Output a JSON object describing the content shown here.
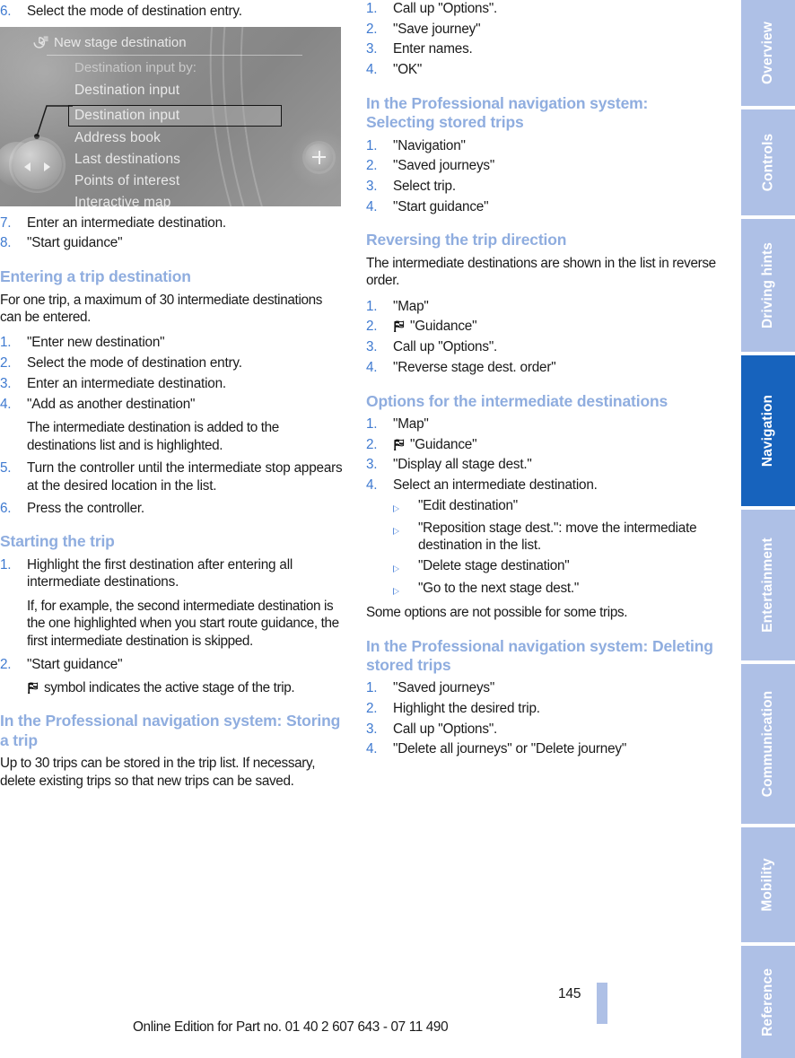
{
  "page": {
    "number": "145",
    "footer_note": "Online Edition for Part no. 01 40 2 607 643 - 07 11 490"
  },
  "colors": {
    "heading_blue": "#8faddf",
    "number_blue": "#3f7ad0",
    "tab_inactive": "#aec0e6",
    "tab_active": "#1763bd",
    "page_bar": "#aec0e6"
  },
  "idrive_screenshot": {
    "title": "New stage destination",
    "title_icon": "navigation-destination-icon",
    "subtitle": "Destination input by:",
    "items": [
      {
        "label": "Destination input",
        "highlighted": true
      },
      {
        "label": "Address book",
        "highlighted": false
      },
      {
        "label": "Last destinations",
        "highlighted": false
      },
      {
        "label": "Points of interest",
        "highlighted": false
      },
      {
        "label": "Interactive map",
        "highlighted": false
      }
    ],
    "controller_icon": "controller-knob-icon",
    "plus_button_icon": "plus-icon"
  },
  "left_column": {
    "step_6": {
      "num": "6.",
      "text": "Select the mode of destination entry."
    },
    "steps_7_8": [
      {
        "num": "7.",
        "text": "Enter an intermediate destination."
      },
      {
        "num": "8.",
        "text": "\"Start guidance\""
      }
    ],
    "entering_trip": {
      "heading": "Entering a trip destination",
      "intro": "For one trip, a maximum of 30 intermediate destinations can be entered.",
      "steps": [
        {
          "num": "1.",
          "text": "\"Enter new destination\""
        },
        {
          "num": "2.",
          "text": "Select the mode of destination entry."
        },
        {
          "num": "3.",
          "text": "Enter an intermediate destination."
        },
        {
          "num": "4.",
          "text": "\"Add as another destination\""
        }
      ],
      "step4_note": "The intermediate destination is added to the destinations list and is highlighted.",
      "steps_cont": [
        {
          "num": "5.",
          "text": "Turn the controller until the intermediate stop appears at the desired location in the list."
        },
        {
          "num": "6.",
          "text": "Press the controller."
        }
      ]
    },
    "starting_trip": {
      "heading": "Starting the trip",
      "step1": {
        "num": "1.",
        "text": "Highlight the first destination after entering all intermediate destinations."
      },
      "step1_note": "If, for example, the second intermediate destination is the one highlighted when you start route guidance, the first intermediate destination is skipped.",
      "step2": {
        "num": "2.",
        "text": "\"Start guidance\""
      },
      "step2_note": "symbol indicates the active stage of the trip.",
      "step2_note_icon": "checkered-flag-icon"
    },
    "storing_trip": {
      "heading": "In the Professional navigation system: Storing a trip",
      "intro": "Up to 30 trips can be stored in the trip list. If necessary, delete existing trips so that new trips can be saved."
    }
  },
  "right_column": {
    "storing_steps": [
      {
        "num": "1.",
        "text": "Call up \"Options\"."
      },
      {
        "num": "2.",
        "text": "\"Save journey\""
      },
      {
        "num": "3.",
        "text": "Enter names."
      },
      {
        "num": "4.",
        "text": "\"OK\""
      }
    ],
    "selecting_trips": {
      "heading": "In the Professional navigation system: Selecting stored trips",
      "steps": [
        {
          "num": "1.",
          "text": "\"Navigation\""
        },
        {
          "num": "2.",
          "text": "\"Saved journeys\""
        },
        {
          "num": "3.",
          "text": "Select trip."
        },
        {
          "num": "4.",
          "text": "\"Start guidance\""
        }
      ]
    },
    "reversing": {
      "heading": "Reversing the trip direction",
      "intro": "The intermediate destinations are shown in the list in reverse order.",
      "steps": [
        {
          "num": "1.",
          "text": "\"Map\"",
          "icon": null
        },
        {
          "num": "2.",
          "text": "\"Guidance\"",
          "icon": "checkered-flag-icon"
        },
        {
          "num": "3.",
          "text": "Call up \"Options\".",
          "icon": null
        },
        {
          "num": "4.",
          "text": "\"Reverse stage dest. order\"",
          "icon": null
        }
      ]
    },
    "options": {
      "heading": "Options for the intermediate destinations",
      "steps": [
        {
          "num": "1.",
          "text": "\"Map\"",
          "icon": null
        },
        {
          "num": "2.",
          "text": "\"Guidance\"",
          "icon": "checkered-flag-icon"
        },
        {
          "num": "3.",
          "text": "\"Display all stage dest.\"",
          "icon": null
        },
        {
          "num": "4.",
          "text": "Select an intermediate destination.",
          "icon": null
        }
      ],
      "sub_items": [
        "\"Edit destination\"",
        "\"Reposition stage dest.\": move the intermediate destination in the list.",
        "\"Delete stage destination\"",
        "\"Go to the next stage dest.\""
      ],
      "note": "Some options are not possible for some trips."
    },
    "deleting_trips": {
      "heading": "In the Professional navigation system: Deleting stored trips",
      "steps": [
        {
          "num": "1.",
          "text": "\"Saved journeys\""
        },
        {
          "num": "2.",
          "text": "Highlight the desired trip."
        },
        {
          "num": "3.",
          "text": "Call up \"Options\"."
        },
        {
          "num": "4.",
          "text": "\"Delete all journeys\" or \"Delete journey\""
        }
      ]
    }
  },
  "rail": {
    "tabs": [
      {
        "label": "Overview",
        "active": false
      },
      {
        "label": "Controls",
        "active": false
      },
      {
        "label": "Driving hints",
        "active": false
      },
      {
        "label": "Navigation",
        "active": true
      },
      {
        "label": "Entertainment",
        "active": false
      },
      {
        "label": "Communication",
        "active": false
      },
      {
        "label": "Mobility",
        "active": false
      },
      {
        "label": "Reference",
        "active": false
      }
    ]
  }
}
